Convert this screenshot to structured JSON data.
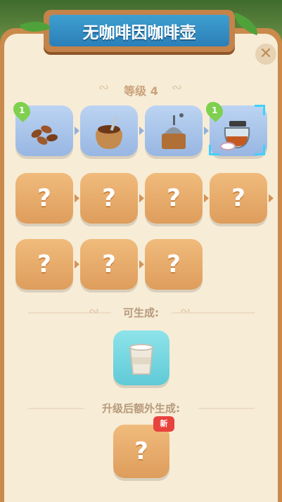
{
  "title": "无咖啡因咖啡壶",
  "level_label": "等级 4",
  "can_generate_label": "可生成:",
  "bonus_label": "升级后额外生成:",
  "locked_symbol": "?",
  "items": [
    {
      "name": "coffee-beans",
      "badge": "1"
    },
    {
      "name": "coffee-bean-sack"
    },
    {
      "name": "coffee-grinder"
    },
    {
      "name": "coffee-pot",
      "badge": "1",
      "selected": true
    }
  ],
  "new_label": "新",
  "close_symbol": "✕",
  "colors": {
    "accent": "#2a7fb8",
    "locked_tile": "#de9d5c",
    "unlocked_tile": "#97b6e2",
    "generate_tile": "#5fcad6",
    "badge_green": "#7fd04e",
    "new_red": "#e8423d"
  }
}
